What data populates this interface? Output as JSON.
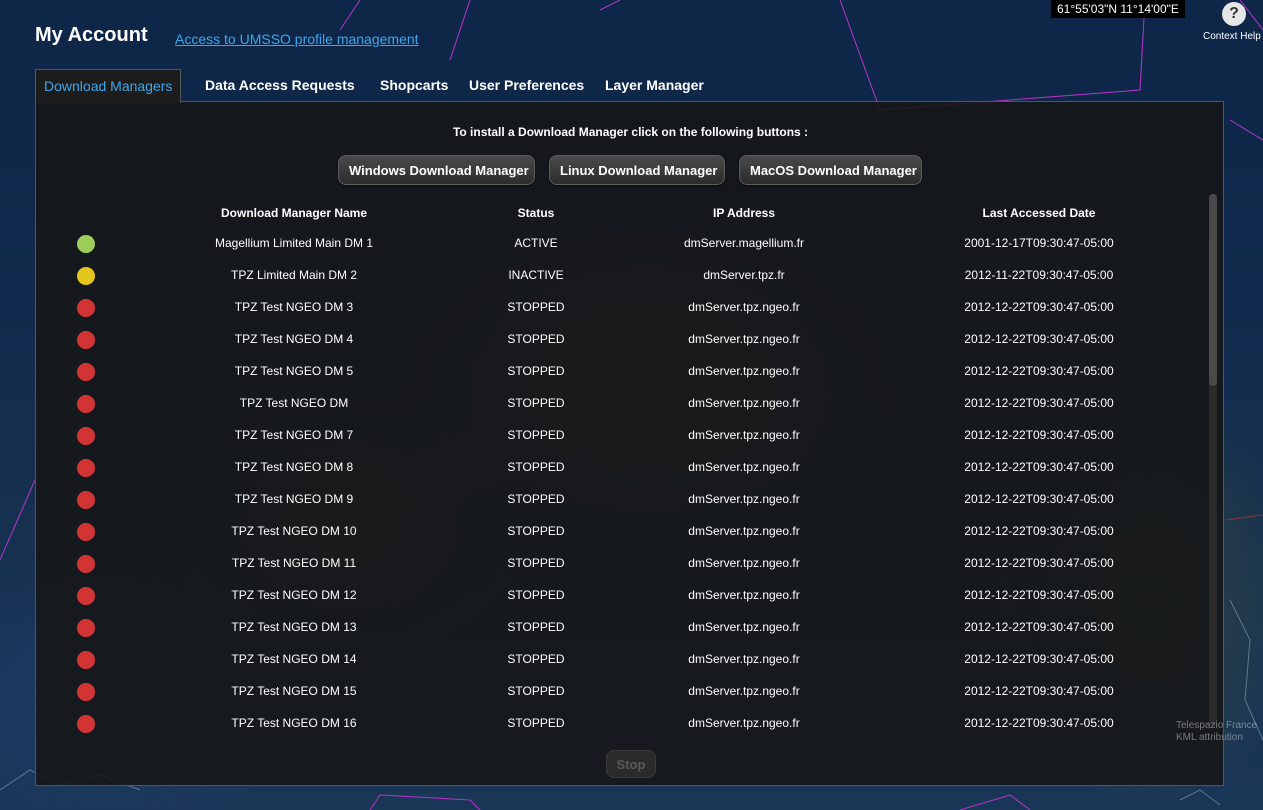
{
  "header": {
    "title": "My Account",
    "profile_link": "Access to UMSSO profile management"
  },
  "map": {
    "coordinates": "61°55'03\"N 11°14'00\"E",
    "attribution_line1": "Telespazio France",
    "attribution_line2": "KML attribution"
  },
  "help": {
    "icon": "?",
    "label": "Context Help"
  },
  "tabs": [
    {
      "label": "Download Managers",
      "active": true
    },
    {
      "label": "Data Access Requests",
      "active": false
    },
    {
      "label": "Shopcarts",
      "active": false
    },
    {
      "label": "User Preferences",
      "active": false
    },
    {
      "label": "Layer Manager",
      "active": false
    }
  ],
  "install": {
    "text": "To install a Download Manager click on the following buttons :",
    "buttons": [
      "Windows Download Manager",
      "Linux Download Manager",
      "MacOS Download Manager"
    ]
  },
  "table": {
    "columns": [
      "Download Manager Name",
      "Status",
      "IP Address",
      "Last Accessed Date"
    ],
    "rows": [
      {
        "name": "Magellium Limited Main DM 1",
        "status": "ACTIVE",
        "ip": "dmServer.magellium.fr",
        "date": "2001-12-17T09:30:47-05:00",
        "color": "#9ccc5a"
      },
      {
        "name": "TPZ Limited Main DM 2",
        "status": "INACTIVE",
        "ip": "dmServer.tpz.fr",
        "date": "2012-11-22T09:30:47-05:00",
        "color": "#e3c71c"
      },
      {
        "name": "TPZ Test NGEO DM 3",
        "status": "STOPPED",
        "ip": "dmServer.tpz.ngeo.fr",
        "date": "2012-12-22T09:30:47-05:00",
        "color": "#d23434"
      },
      {
        "name": "TPZ Test NGEO DM 4",
        "status": "STOPPED",
        "ip": "dmServer.tpz.ngeo.fr",
        "date": "2012-12-22T09:30:47-05:00",
        "color": "#d23434"
      },
      {
        "name": "TPZ Test NGEO DM 5",
        "status": "STOPPED",
        "ip": "dmServer.tpz.ngeo.fr",
        "date": "2012-12-22T09:30:47-05:00",
        "color": "#d23434"
      },
      {
        "name": "TPZ Test NGEO DM",
        "status": "STOPPED",
        "ip": "dmServer.tpz.ngeo.fr",
        "date": "2012-12-22T09:30:47-05:00",
        "color": "#d23434"
      },
      {
        "name": "TPZ Test NGEO DM 7",
        "status": "STOPPED",
        "ip": "dmServer.tpz.ngeo.fr",
        "date": "2012-12-22T09:30:47-05:00",
        "color": "#d23434"
      },
      {
        "name": "TPZ Test NGEO DM 8",
        "status": "STOPPED",
        "ip": "dmServer.tpz.ngeo.fr",
        "date": "2012-12-22T09:30:47-05:00",
        "color": "#d23434"
      },
      {
        "name": "TPZ Test NGEO DM 9",
        "status": "STOPPED",
        "ip": "dmServer.tpz.ngeo.fr",
        "date": "2012-12-22T09:30:47-05:00",
        "color": "#d23434"
      },
      {
        "name": "TPZ Test NGEO DM 10",
        "status": "STOPPED",
        "ip": "dmServer.tpz.ngeo.fr",
        "date": "2012-12-22T09:30:47-05:00",
        "color": "#d23434"
      },
      {
        "name": "TPZ Test NGEO DM 11",
        "status": "STOPPED",
        "ip": "dmServer.tpz.ngeo.fr",
        "date": "2012-12-22T09:30:47-05:00",
        "color": "#d23434"
      },
      {
        "name": "TPZ Test NGEO DM 12",
        "status": "STOPPED",
        "ip": "dmServer.tpz.ngeo.fr",
        "date": "2012-12-22T09:30:47-05:00",
        "color": "#d23434"
      },
      {
        "name": "TPZ Test NGEO DM 13",
        "status": "STOPPED",
        "ip": "dmServer.tpz.ngeo.fr",
        "date": "2012-12-22T09:30:47-05:00",
        "color": "#d23434"
      },
      {
        "name": "TPZ Test NGEO DM 14",
        "status": "STOPPED",
        "ip": "dmServer.tpz.ngeo.fr",
        "date": "2012-12-22T09:30:47-05:00",
        "color": "#d23434"
      },
      {
        "name": "TPZ Test NGEO DM 15",
        "status": "STOPPED",
        "ip": "dmServer.tpz.ngeo.fr",
        "date": "2012-12-22T09:30:47-05:00",
        "color": "#d23434"
      },
      {
        "name": "TPZ Test NGEO DM 16",
        "status": "STOPPED",
        "ip": "dmServer.tpz.ngeo.fr",
        "date": "2012-12-22T09:30:47-05:00",
        "color": "#d23434"
      }
    ]
  },
  "actions": {
    "stop_label": "Stop"
  }
}
